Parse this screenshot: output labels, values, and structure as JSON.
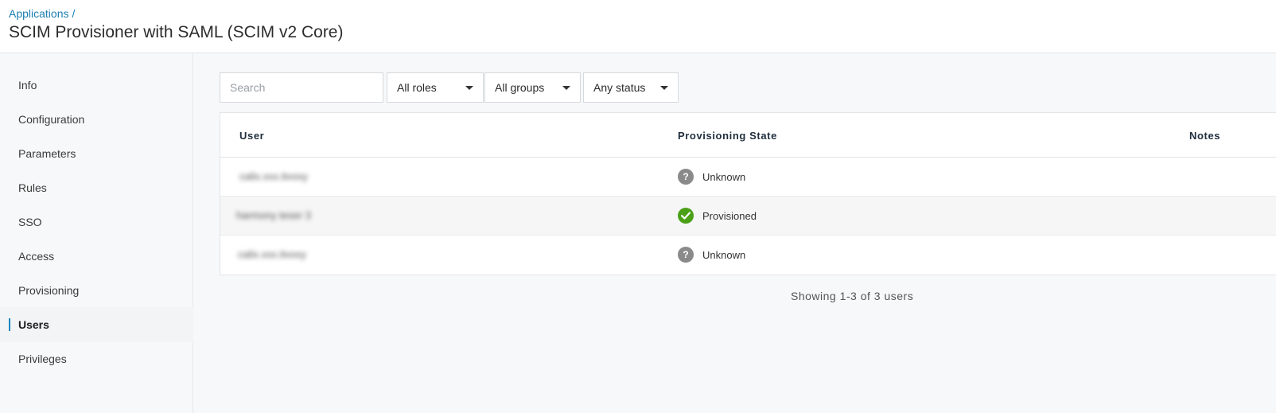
{
  "header": {
    "breadcrumb": "Applications",
    "breadcrumb_sep": "/",
    "title": "SCIM Provisioner with SAML (SCIM v2 Core)"
  },
  "sidebar": {
    "items": [
      {
        "label": "Info"
      },
      {
        "label": "Configuration"
      },
      {
        "label": "Parameters"
      },
      {
        "label": "Rules"
      },
      {
        "label": "SSO"
      },
      {
        "label": "Access"
      },
      {
        "label": "Provisioning"
      },
      {
        "label": "Users",
        "active": true
      },
      {
        "label": "Privileges"
      }
    ]
  },
  "filters": {
    "search_placeholder": "Search",
    "roles": "All roles",
    "groups": "All groups",
    "status": "Any status"
  },
  "table": {
    "columns": [
      "User",
      "Provisioning State",
      "Notes"
    ],
    "rows": [
      {
        "user": "calix.xxx.tivoxy",
        "state": "Unknown",
        "status": "unknown"
      },
      {
        "user": "harmony teser 3",
        "state": "Provisioned",
        "status": "ok"
      },
      {
        "user": "calix.xxx.tivoxy",
        "state": "Unknown",
        "status": "unknown"
      }
    ]
  },
  "pager": {
    "text": "Showing 1-3 of 3 users"
  },
  "colors": {
    "accent": "#1a86c2",
    "link": "#1a7fb0",
    "success": "#4aa118",
    "unknown": "#8a8a8a"
  },
  "icons": {
    "unknown": "question-circle-icon",
    "ok": "check-circle-icon",
    "dropdown": "caret-down-icon"
  }
}
